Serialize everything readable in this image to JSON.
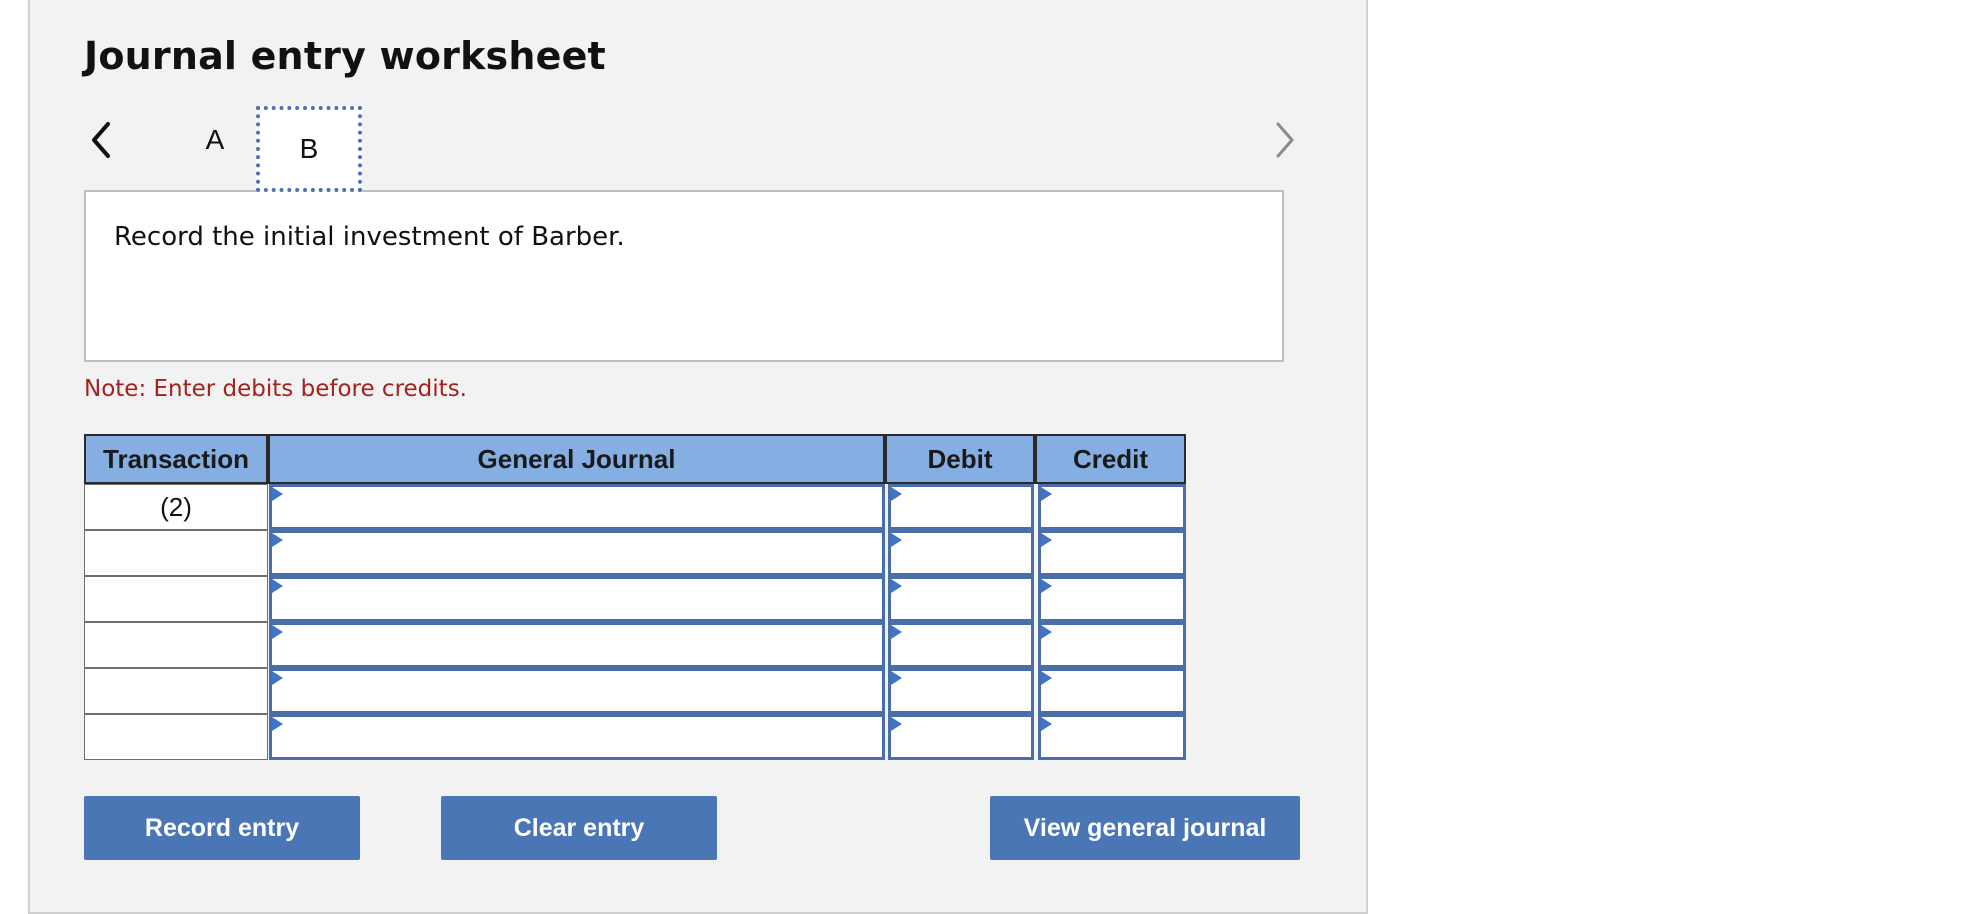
{
  "worksheet": {
    "title": "Journal entry worksheet",
    "tabs": [
      {
        "label": "A",
        "selected": false
      },
      {
        "label": "B",
        "selected": true
      }
    ],
    "prompt": "Record the initial investment of Barber.",
    "note": "Note: Enter debits before credits."
  },
  "journal": {
    "headers": {
      "transaction": "Transaction",
      "general_journal": "General Journal",
      "debit": "Debit",
      "credit": "Credit"
    },
    "rows": [
      {
        "transaction": "(2)",
        "account": "",
        "debit": "",
        "credit": ""
      },
      {
        "transaction": "",
        "account": "",
        "debit": "",
        "credit": ""
      },
      {
        "transaction": "",
        "account": "",
        "debit": "",
        "credit": ""
      },
      {
        "transaction": "",
        "account": "",
        "debit": "",
        "credit": ""
      },
      {
        "transaction": "",
        "account": "",
        "debit": "",
        "credit": ""
      },
      {
        "transaction": "",
        "account": "",
        "debit": "",
        "credit": ""
      }
    ]
  },
  "buttons": {
    "record": "Record entry",
    "clear": "Clear entry",
    "view": "View general journal"
  },
  "icons": {
    "prev": "chevron-left-icon",
    "next": "chevron-right-icon",
    "dropdown": "dropdown-triangle-icon"
  },
  "colors": {
    "header_bg": "#85aee3",
    "button_bg": "#4a76b6",
    "input_border": "#4a6fa8",
    "note_text": "#a4221c",
    "tab_focus": "#4a72b4"
  }
}
